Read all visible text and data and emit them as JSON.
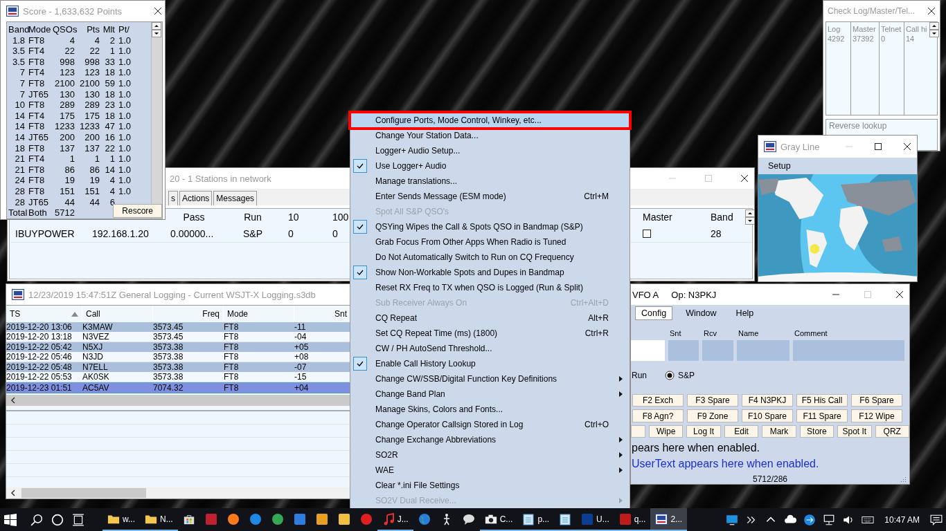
{
  "check_log_window": {
    "title": "Check Log/Master/Tel...",
    "columns": [
      {
        "label": "Log",
        "value": "4292"
      },
      {
        "label": "Master",
        "value": "37392"
      },
      {
        "label": "Telnet",
        "value": "0"
      },
      {
        "label": "Call hi",
        "value": "14"
      }
    ],
    "reverse_lookup": "Reverse lookup"
  },
  "gray_line_window": {
    "title": "Gray Line",
    "menus": [
      "Setup"
    ]
  },
  "network_window": {
    "title": "20 - 1 Stations in network",
    "tabs": [
      {
        "label": "s",
        "selected": false
      },
      {
        "label": "Actions",
        "selected": false
      },
      {
        "label": "Messages",
        "selected": false
      }
    ],
    "headers": [
      "Pass",
      "Run",
      "10",
      "100"
    ],
    "right_headers": [
      "Master",
      "Band"
    ],
    "row": {
      "cells": [
        "IBUYPOWER",
        "192.168.1.20",
        "0.00000...",
        "S&P",
        "0",
        "0"
      ],
      "master": {
        "checked": false
      },
      "band": "28"
    }
  },
  "score_window": {
    "title": "Score - 1,633,632 Points",
    "columns": [
      "Band",
      "Mode",
      "QSOs",
      "Pts",
      "Mlt",
      "Pt/"
    ],
    "rows": [
      {
        "cells": [
          "1.8",
          "FT8",
          "4",
          "4",
          "2",
          "1.0"
        ]
      },
      {
        "cells": [
          "3.5",
          "FT4",
          "22",
          "22",
          "1",
          "1.0"
        ]
      },
      {
        "cells": [
          "3.5",
          "FT8",
          "998",
          "998",
          "33",
          "1.0"
        ]
      },
      {
        "cells": [
          "7",
          "FT4",
          "123",
          "123",
          "18",
          "1.0"
        ]
      },
      {
        "cells": [
          "7",
          "FT8",
          "2100",
          "2100",
          "59",
          "1.0"
        ]
      },
      {
        "cells": [
          "7",
          "JT65",
          "130",
          "130",
          "18",
          "1.0"
        ]
      },
      {
        "cells": [
          "10",
          "FT8",
          "289",
          "289",
          "23",
          "1.0"
        ]
      },
      {
        "cells": [
          "14",
          "FT4",
          "175",
          "175",
          "18",
          "1.0"
        ]
      },
      {
        "cells": [
          "14",
          "FT8",
          "1233",
          "1233",
          "47",
          "1.0"
        ]
      },
      {
        "cells": [
          "14",
          "JT65",
          "200",
          "200",
          "16",
          "1.0"
        ]
      },
      {
        "cells": [
          "18",
          "FT8",
          "137",
          "137",
          "22",
          "1.0"
        ]
      },
      {
        "cells": [
          "21",
          "FT4",
          "1",
          "1",
          "1",
          "1.0"
        ]
      },
      {
        "cells": [
          "21",
          "FT8",
          "86",
          "86",
          "14",
          "1.0"
        ]
      },
      {
        "cells": [
          "24",
          "FT8",
          "19",
          "19",
          "4",
          "1.0"
        ]
      },
      {
        "cells": [
          "28",
          "FT8",
          "151",
          "151",
          "4",
          "1.0"
        ]
      },
      {
        "cells": [
          "28",
          "JT65",
          "44",
          "44",
          "6"
        ]
      },
      {
        "cells": [
          "Total",
          "Both",
          "5712"
        ]
      }
    ],
    "rescore_button": "Rescore"
  },
  "logging_window": {
    "title": "12/23/2019 15:47:51Z  General Logging - Current WSJT-X Logging.s3db",
    "columns": [
      "TS",
      "Call",
      "Freq",
      "Mode",
      "Snt"
    ],
    "rows": [
      {
        "cells": [
          "2019-12-20 13:06",
          "K3MAW",
          "3573.45",
          "FT8",
          "-11"
        ],
        "selected": false
      },
      {
        "cells": [
          "2019-12-20 13:18",
          "N3VEZ",
          "3573.45",
          "FT8",
          "-04"
        ],
        "selected": false
      },
      {
        "cells": [
          "2019-12-22 05:42",
          "N5XJ",
          "3573.38",
          "FT8",
          "+05"
        ],
        "selected": false
      },
      {
        "cells": [
          "2019-12-22 05:46",
          "N3JD",
          "3573.38",
          "FT8",
          "+08"
        ],
        "selected": false
      },
      {
        "cells": [
          "2019-12-22 05:48",
          "N7ELL",
          "3573.38",
          "FT8",
          "-07"
        ],
        "selected": false
      },
      {
        "cells": [
          "2019-12-22 05:53",
          "AK0SK",
          "3573.38",
          "FT8",
          "-15"
        ],
        "selected": false
      },
      {
        "cells": [
          "2019-12-23 01:51",
          "AC5AV",
          "7074.32",
          "FT8",
          "+04"
        ],
        "selected": true
      }
    ]
  },
  "entry_window": {
    "title": "VFO A",
    "operator": "Op: N3PKJ",
    "menus": [
      {
        "label": "Config",
        "selected": true
      },
      {
        "label": "Window",
        "selected": false
      },
      {
        "label": "Help",
        "selected": false
      }
    ],
    "field_labels": [
      "Snt",
      "Rcv",
      "Name",
      "Comment"
    ],
    "run_label": "Run",
    "sp_option": {
      "label": "S&P",
      "selected": true
    },
    "key_rows": [
      [
        {
          "kind": "key",
          "label": "F2 Exch"
        },
        {
          "kind": "key",
          "label": "F3 Spare"
        },
        {
          "kind": "key",
          "label": "F4 N3PKJ"
        },
        {
          "kind": "key",
          "label": "F5 His Call"
        },
        {
          "kind": "key",
          "label": "F6 Spare"
        }
      ],
      [
        {
          "kind": "key",
          "label": "F8 Agn?"
        },
        {
          "kind": "key",
          "label": "F9 Zone"
        },
        {
          "kind": "key",
          "label": "F10 Spare"
        },
        {
          "kind": "key",
          "label": "F11 Spare"
        },
        {
          "kind": "key",
          "label": "F12 Wipe"
        }
      ],
      [
        {
          "kind": "blank"
        },
        {
          "kind": "key",
          "label": "Wipe"
        },
        {
          "kind": "key",
          "label": "Log It"
        },
        {
          "kind": "key",
          "label": "Edit"
        },
        {
          "kind": "key",
          "label": "Mark"
        },
        {
          "kind": "key",
          "label": "Store"
        },
        {
          "kind": "key",
          "label": "Spot It"
        },
        {
          "kind": "key",
          "label": "QRZ"
        }
      ]
    ],
    "info_text": "pears here when enabled.",
    "user_text": "UserText appears here when enabled.",
    "status": "5712/286"
  },
  "menu": {
    "items": [
      {
        "label": "Configure Ports, Mode Control, Winkey, etc...",
        "checked": false,
        "disabled": false,
        "submenu": false,
        "selected": true,
        "outlined": true
      },
      {
        "label": "Change Your Station Data...",
        "checked": false,
        "disabled": false,
        "submenu": false,
        "selected": false,
        "outlined": false
      },
      {
        "label": "Logger+ Audio Setup...",
        "checked": false,
        "disabled": false,
        "submenu": false,
        "selected": false,
        "outlined": false
      },
      {
        "label": "Use Logger+ Audio",
        "checked": true,
        "disabled": false,
        "submenu": false,
        "selected": false,
        "outlined": false
      },
      {
        "label": "Manage translations...",
        "checked": false,
        "disabled": false,
        "submenu": false,
        "selected": false,
        "outlined": false
      },
      {
        "label": "Enter Sends Message (ESM mode)",
        "shortcut": "Ctrl+M",
        "checked": false,
        "disabled": false,
        "submenu": false,
        "selected": false,
        "outlined": false
      },
      {
        "label": "Spot All S&P QSO's",
        "checked": false,
        "disabled": true,
        "submenu": false,
        "selected": false,
        "outlined": false
      },
      {
        "label": "QSYing Wipes the Call & Spots QSO in Bandmap (S&P)",
        "checked": true,
        "disabled": false,
        "submenu": false,
        "selected": false,
        "outlined": false
      },
      {
        "label": "Grab Focus From Other Apps When Radio is Tuned",
        "checked": false,
        "disabled": false,
        "submenu": false,
        "selected": false,
        "outlined": false
      },
      {
        "label": "Do Not Automatically Switch to Run on CQ Frequency",
        "checked": false,
        "disabled": false,
        "submenu": false,
        "selected": false,
        "outlined": false
      },
      {
        "label": "Show Non-Workable Spots and Dupes in Bandmap",
        "checked": true,
        "disabled": false,
        "submenu": false,
        "selected": false,
        "outlined": false
      },
      {
        "label": "Reset RX Freq to TX when QSO is Logged (Run & Split)",
        "checked": false,
        "disabled": false,
        "submenu": false,
        "selected": false,
        "outlined": false
      },
      {
        "label": "Sub Receiver Always On",
        "shortcut": "Ctrl+Alt+D",
        "checked": false,
        "disabled": true,
        "submenu": false,
        "selected": false,
        "outlined": false
      },
      {
        "label": "CQ Repeat",
        "shortcut": "Alt+R",
        "checked": false,
        "disabled": false,
        "submenu": false,
        "selected": false,
        "outlined": false
      },
      {
        "label": "Set CQ Repeat Time (ms) (1800)",
        "shortcut": "Ctrl+R",
        "checked": false,
        "disabled": false,
        "submenu": false,
        "selected": false,
        "outlined": false
      },
      {
        "label": "CW / PH AutoSend Threshold...",
        "checked": false,
        "disabled": false,
        "submenu": false,
        "selected": false,
        "outlined": false
      },
      {
        "label": "Enable Call History Lookup",
        "checked": true,
        "disabled": false,
        "submenu": false,
        "selected": false,
        "outlined": false
      },
      {
        "label": "Change CW/SSB/Digital Function Key Definitions",
        "checked": false,
        "disabled": false,
        "submenu": true,
        "selected": false,
        "outlined": false
      },
      {
        "label": "Change Band Plan",
        "checked": false,
        "disabled": false,
        "submenu": true,
        "selected": false,
        "outlined": false
      },
      {
        "label": "Manage Skins, Colors and Fonts...",
        "checked": false,
        "disabled": false,
        "submenu": false,
        "selected": false,
        "outlined": false
      },
      {
        "label": "Change Operator Callsign Stored in Log",
        "shortcut": "Ctrl+O",
        "checked": false,
        "disabled": false,
        "submenu": false,
        "selected": false,
        "outlined": false
      },
      {
        "label": "Change Exchange Abbreviations",
        "checked": false,
        "disabled": false,
        "submenu": true,
        "selected": false,
        "outlined": false
      },
      {
        "label": "SO2R",
        "checked": false,
        "disabled": false,
        "submenu": true,
        "selected": false,
        "outlined": false
      },
      {
        "label": "WAE",
        "checked": false,
        "disabled": false,
        "submenu": true,
        "selected": false,
        "outlined": false
      },
      {
        "label": "Clear *.ini File Settings",
        "checked": false,
        "disabled": false,
        "submenu": false,
        "selected": false,
        "outlined": false
      },
      {
        "label": "SO2V Dual Receive...",
        "checked": false,
        "disabled": true,
        "submenu": true,
        "selected": false,
        "outlined": false
      }
    ]
  },
  "taskbar": {
    "items": [
      {
        "kind": "folder",
        "label": "w...",
        "running": true,
        "selected": false
      },
      {
        "kind": "folder",
        "label": "N...",
        "running": true,
        "selected": false
      },
      {
        "kind": "store",
        "running": false,
        "selected": false
      },
      {
        "kind": "square",
        "color": "#c02030",
        "running": false,
        "selected": false
      },
      {
        "kind": "circle",
        "color": "#ff7a1a",
        "running": false,
        "selected": false
      },
      {
        "kind": "circle",
        "color": "#1e88e5",
        "running": false,
        "selected": false
      },
      {
        "kind": "circle",
        "color": "#34a853",
        "running": false,
        "selected": false
      },
      {
        "kind": "square",
        "color": "#2f7de0",
        "running": false,
        "selected": false
      },
      {
        "kind": "square",
        "color": "#e8a020",
        "running": false,
        "selected": false
      },
      {
        "kind": "square",
        "color": "#f0c040",
        "running": false,
        "selected": false
      },
      {
        "kind": "circle",
        "color": "#e02020",
        "running": false,
        "selected": false
      },
      {
        "kind": "note",
        "label": "J...",
        "running": true,
        "selected": false
      },
      {
        "kind": "globe",
        "running": false,
        "selected": false
      },
      {
        "kind": "figure",
        "running": false,
        "selected": false
      },
      {
        "kind": "bubble",
        "running": false,
        "selected": false
      },
      {
        "kind": "camera",
        "label": "C...",
        "running": true,
        "selected": false
      },
      {
        "kind": "notepad",
        "label": "p...",
        "running": true,
        "selected": false
      },
      {
        "kind": "notepad",
        "running": true,
        "selected": false
      },
      {
        "kind": "square",
        "color": "#0b3d91",
        "label": "U...",
        "running": true,
        "selected": false
      },
      {
        "kind": "square",
        "color": "#bf1b1b",
        "label": "q...",
        "running": true,
        "selected": false
      },
      {
        "kind": "logo",
        "label": "2...",
        "running": true,
        "selected": true
      }
    ],
    "clock": "10:47 AM"
  }
}
